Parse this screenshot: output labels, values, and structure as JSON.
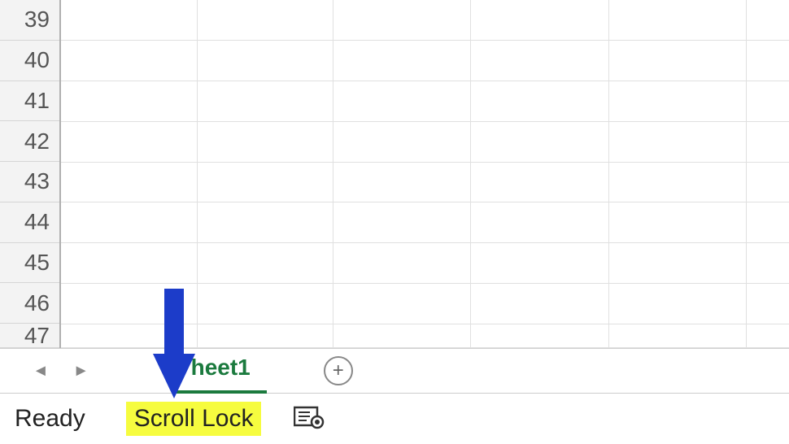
{
  "grid": {
    "row_numbers": [
      39,
      40,
      41,
      42,
      43,
      44,
      45,
      46,
      47
    ]
  },
  "tabs": {
    "active_sheet": "Sheet1",
    "display_sheet": "heet1"
  },
  "status": {
    "ready": "Ready",
    "scroll_lock": "Scroll Lock"
  },
  "annotation": {
    "arrow_color": "#1c3cc9",
    "highlight_color": "#f6fc3f"
  }
}
